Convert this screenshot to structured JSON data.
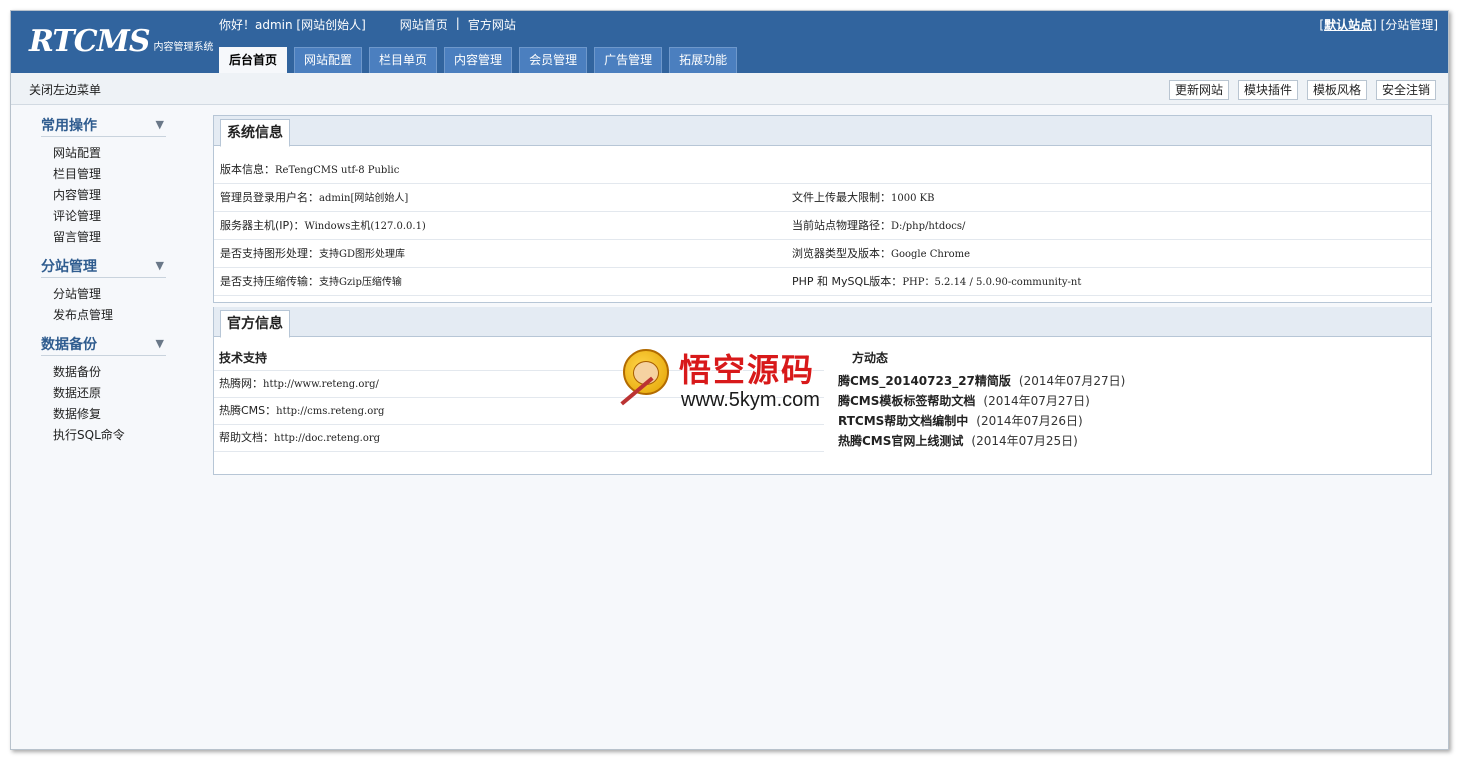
{
  "header": {
    "logo_main": "RTCMS",
    "logo_sub": "内容管理系统",
    "greeting": "你好！admin [网站创始人]",
    "home_link": "网站首页",
    "separator": "|",
    "official_link": "官方网站",
    "default_site": "默认站点",
    "branch_manage": "分站管理"
  },
  "tabs": [
    {
      "label": "后台首页",
      "active": true
    },
    {
      "label": "网站配置"
    },
    {
      "label": "栏目单页"
    },
    {
      "label": "内容管理"
    },
    {
      "label": "会员管理"
    },
    {
      "label": "广告管理"
    },
    {
      "label": "拓展功能"
    }
  ],
  "toolbar": {
    "close_menu": "关闭左边菜单",
    "buttons": [
      "更新网站",
      "模块插件",
      "模板风格",
      "安全注销"
    ]
  },
  "sidebar": {
    "groups": [
      {
        "title": "常用操作",
        "items": [
          "网站配置",
          "栏目管理",
          "内容管理",
          "评论管理",
          "留言管理"
        ]
      },
      {
        "title": "分站管理",
        "items": [
          "分站管理",
          "发布点管理"
        ]
      },
      {
        "title": "数据备份",
        "items": [
          "数据备份",
          "数据还原",
          "数据修复",
          "执行SQL命令"
        ]
      }
    ]
  },
  "system_info": {
    "title": "系统信息",
    "version_label": "版本信息：",
    "version_value": "ReTengCMS utf-8 Public",
    "rows": [
      {
        "l_label": "管理员登录用户名：",
        "l_value": "admin[网站创始人]",
        "r_label": "文件上传最大限制：",
        "r_value": "1000 KB"
      },
      {
        "l_label": "服务器主机(IP)：",
        "l_value": "Windows主机(127.0.0.1)",
        "r_label": "当前站点物理路径：",
        "r_value": "D:/php/htdocs/"
      },
      {
        "l_label": "是否支持图形处理：",
        "l_value": "支持GD图形处理库",
        "r_label": "浏览器类型及版本：",
        "r_value": "Google Chrome"
      },
      {
        "l_label": "是否支持压缩传输：",
        "l_value": "支持Gzip压缩传输",
        "r_label": "PHP 和 MySQL版本：",
        "r_value": "PHP：5.2.14  / 5.0.90-community-nt"
      }
    ]
  },
  "official_info": {
    "title": "官方信息",
    "support_head": "技术支持",
    "support_rows": [
      {
        "label": "热腾网：",
        "value": "http://www.reteng.org/"
      },
      {
        "label": "热腾CMS：",
        "value": "http://cms.reteng.org"
      },
      {
        "label": "帮助文档：",
        "value": "http://doc.reteng.org"
      }
    ],
    "news_head": "方动态",
    "news": [
      {
        "title": "腾CMS_20140723_27精简版",
        "date": "(2014年07月27日)"
      },
      {
        "title": "腾CMS模板标签帮助文档",
        "date": "(2014年07月27日)"
      },
      {
        "title": "RTCMS帮助文档编制中",
        "date": "(2014年07月26日)"
      },
      {
        "title": "热腾CMS官网上线测试",
        "date": "(2014年07月25日)"
      }
    ]
  },
  "watermark": {
    "title": "悟空源码",
    "url": "www.5kym.com"
  }
}
